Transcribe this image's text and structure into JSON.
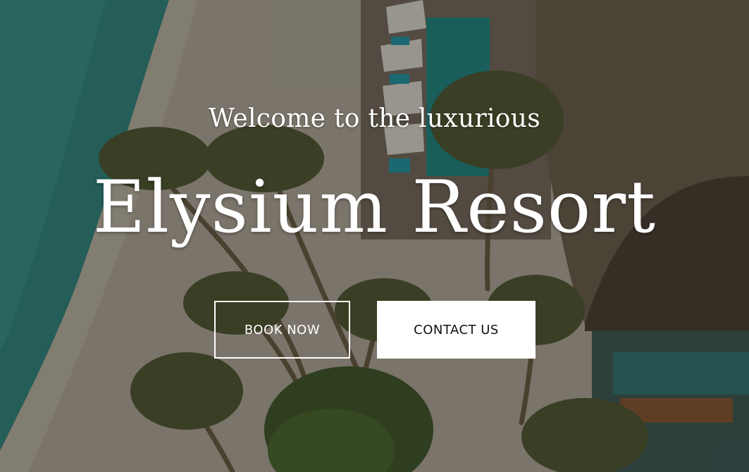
{
  "hero": {
    "subtitle": "Welcome to the luxurious",
    "title": "Elysium Resort",
    "book_label": "BOOK NOW",
    "contact_label": "CONTACT US"
  },
  "colors": {
    "text": "#ffffff",
    "contact_bg": "#ffffff",
    "contact_text": "#111111"
  }
}
